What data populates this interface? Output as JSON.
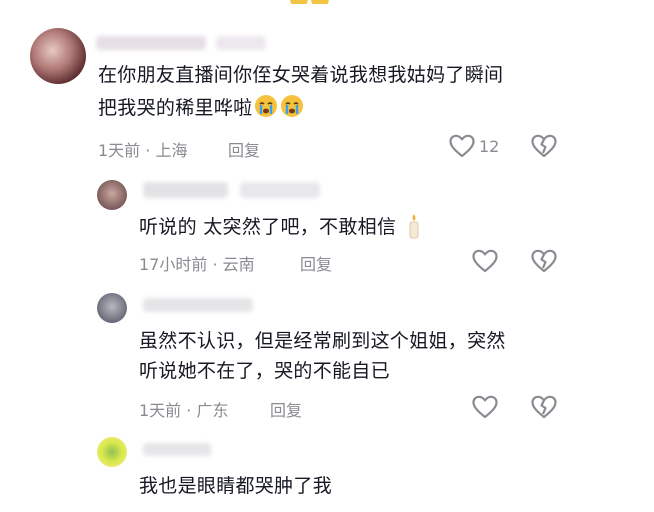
{
  "comments": [
    {
      "text_lines": [
        "在你朋友直播间你侄女哭着说我想我姑妈了瞬间",
        "把我哭的稀里哗啦"
      ],
      "emojis": [
        "crying-face",
        "crying-face"
      ],
      "time": "1天前",
      "location": "上海",
      "reply_label": "回复",
      "likes": "12"
    },
    {
      "text_lines": [
        "听说的 太突然了吧，不敢相信"
      ],
      "emojis": [
        "candle"
      ],
      "time": "17小时前",
      "location": "云南",
      "reply_label": "回复"
    },
    {
      "text_lines": [
        "虽然不认识，但是经常刷到这个姐姐，突然",
        "听说她不在了，哭的不能自已"
      ],
      "time": "1天前",
      "location": "广东",
      "reply_label": "回复"
    },
    {
      "text_lines": [
        "我也是眼睛都哭肿了我"
      ]
    }
  ],
  "meta_separator": "·",
  "colors": {
    "text": "#161823",
    "meta": "#8a8b91",
    "icon": "#8a8b91"
  }
}
